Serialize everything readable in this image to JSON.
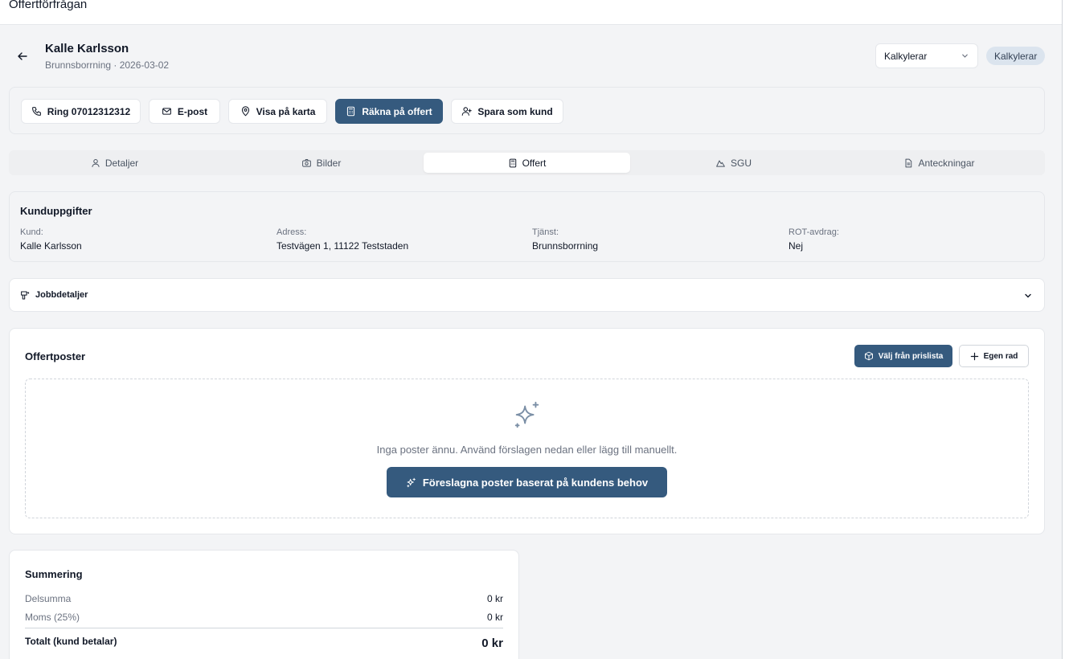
{
  "app": {
    "title": "Offertförfrågan"
  },
  "header": {
    "customer_name": "Kalle Karlsson",
    "subtitle": "Brunnsborrning · 2026-03-02",
    "status_select_value": "Kalkylerar",
    "status_badge": "Kalkylerar"
  },
  "actions": {
    "call": "Ring 07012312312",
    "email": "E-post",
    "map": "Visa på karta",
    "calculate": "Räkna på offert",
    "save_customer": "Spara som kund"
  },
  "tabs": [
    {
      "label": "Detaljer",
      "icon": "user-icon"
    },
    {
      "label": "Bilder",
      "icon": "camera-icon"
    },
    {
      "label": "Offert",
      "icon": "calculator-icon",
      "active": true
    },
    {
      "label": "SGU",
      "icon": "mountain-icon"
    },
    {
      "label": "Anteckningar",
      "icon": "document-icon"
    }
  ],
  "customer_info": {
    "title": "Kunduppgifter",
    "fields": [
      {
        "label": "Kund:",
        "value": "Kalle Karlsson"
      },
      {
        "label": "Adress:",
        "value": "Testvägen 1, 11122 Teststaden"
      },
      {
        "label": "Tjänst:",
        "value": "Brunnsborrning"
      },
      {
        "label": "ROT-avdrag:",
        "value": "Nej"
      }
    ]
  },
  "job_details": {
    "title": "Jobbdetaljer"
  },
  "quote_items": {
    "title": "Offertposter",
    "pricelist_button": "Välj från prislista",
    "custom_row_button": "Egen rad",
    "empty_text": "Inga poster ännu. Använd förslagen nedan eller lägg till manuellt.",
    "suggest_button": "Föreslagna poster baserat på kundens behov"
  },
  "summary": {
    "title": "Summering",
    "subtotal_label": "Delsumma",
    "subtotal_value": "0 kr",
    "vat_label": "Moms (25%)",
    "vat_value": "0 kr",
    "total_label": "Totalt (kund betalar)",
    "total_value": "0 kr"
  },
  "colors": {
    "primary": "#355a7e",
    "background": "#f3f4f6",
    "badge_bg": "#dbe4ee"
  }
}
